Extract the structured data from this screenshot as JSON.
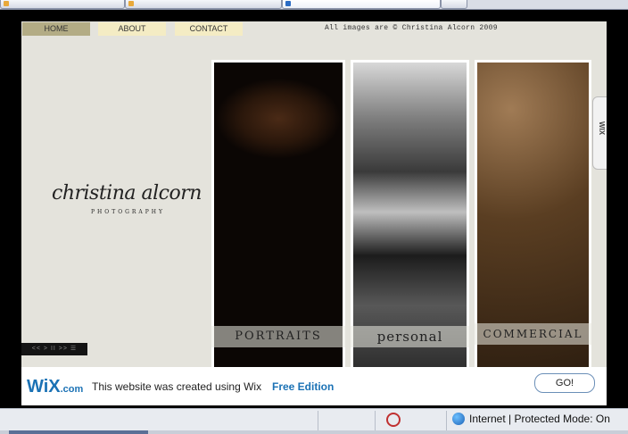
{
  "nav": {
    "home": "HOME",
    "about": "ABOUT",
    "contact": "CONTACT"
  },
  "copyright": "All images are © Christina Alcorn 2009",
  "logo": {
    "name": "christina alcorn",
    "subtitle": "PHOTOGRAPHY"
  },
  "panels": [
    {
      "caption": "PORTRAITS"
    },
    {
      "caption": "personal"
    },
    {
      "caption": "COMMERCIAL"
    }
  ],
  "player": {
    "controls": "<< > II >> ☰"
  },
  "wix_tab": {
    "label": "WIX"
  },
  "banner": {
    "logo": "WiX",
    "logo_suffix": ".com",
    "text": "This website was created using Wix",
    "free_edition": "Free Edition",
    "go": "GO!"
  },
  "statusbar": {
    "zone": "Internet | Protected Mode: On"
  }
}
